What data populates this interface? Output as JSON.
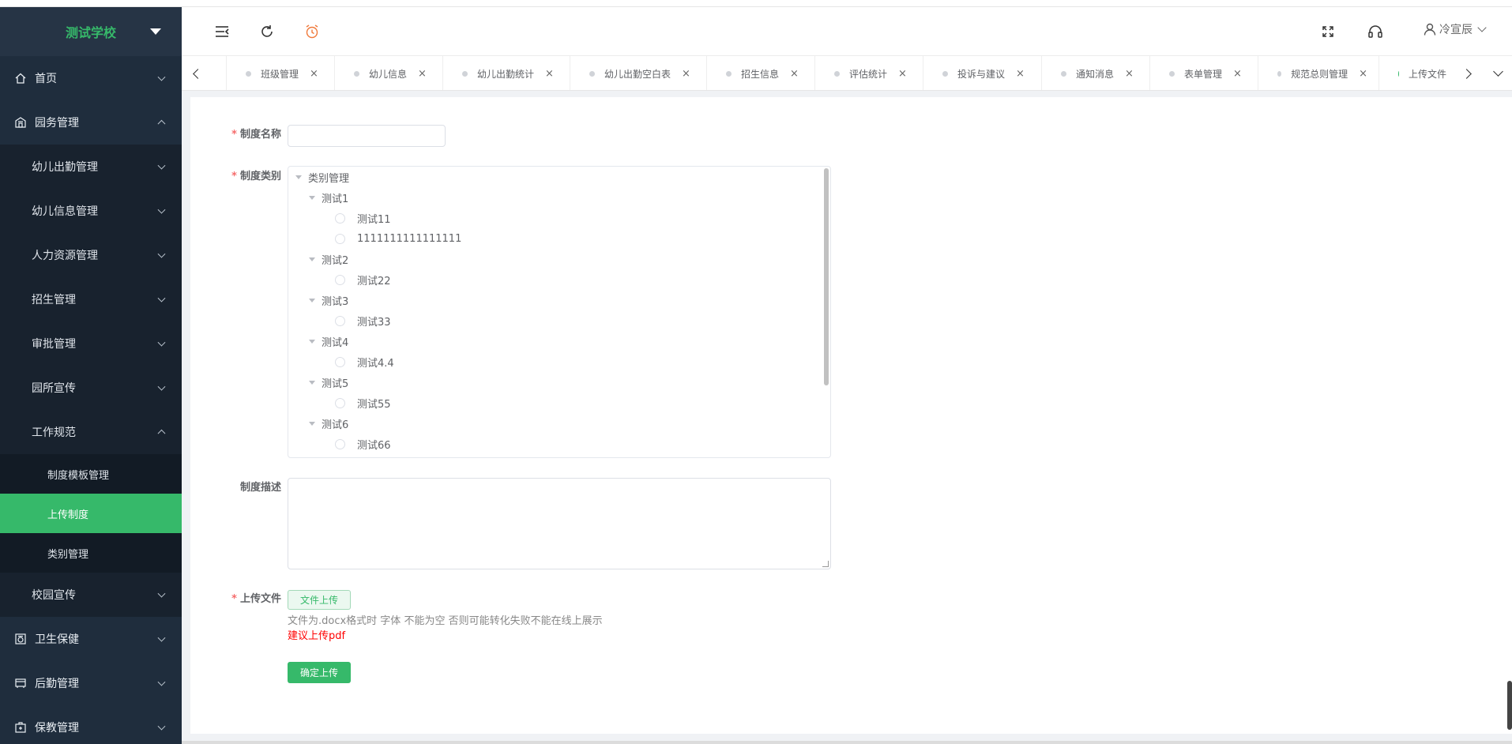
{
  "brand": {
    "title": "测试学校"
  },
  "sidebar": {
    "items": [
      {
        "label": "首页",
        "level": "top",
        "expanded": false,
        "icon": "home-icon"
      },
      {
        "label": "园务管理",
        "level": "top",
        "expanded": true,
        "icon": "building-icon"
      },
      {
        "label": "幼儿出勤管理",
        "level": "sub",
        "expanded": false
      },
      {
        "label": "幼儿信息管理",
        "level": "sub",
        "expanded": false
      },
      {
        "label": "人力资源管理",
        "level": "sub",
        "expanded": false
      },
      {
        "label": "招生管理",
        "level": "sub",
        "expanded": false
      },
      {
        "label": "审批管理",
        "level": "sub",
        "expanded": false
      },
      {
        "label": "园所宣传",
        "level": "sub",
        "expanded": false
      },
      {
        "label": "工作规范",
        "level": "sub",
        "expanded": true
      },
      {
        "label": "制度模板管理",
        "level": "subsub"
      },
      {
        "label": "上传制度",
        "level": "subsub",
        "active": true
      },
      {
        "label": "类别管理",
        "level": "subsub"
      },
      {
        "label": "校园宣传",
        "level": "sub",
        "expanded": false
      },
      {
        "label": "卫生保健",
        "level": "top",
        "expanded": false,
        "icon": "health-icon"
      },
      {
        "label": "后勤管理",
        "level": "top",
        "expanded": false,
        "icon": "logistics-icon"
      },
      {
        "label": "保教管理",
        "level": "top",
        "expanded": false,
        "icon": "education-icon"
      }
    ]
  },
  "header": {
    "user_name": "冷宣辰"
  },
  "tabs": [
    {
      "label": "班级管理"
    },
    {
      "label": "幼儿信息"
    },
    {
      "label": "幼儿出勤统计"
    },
    {
      "label": "幼儿出勤空白表"
    },
    {
      "label": "招生信息"
    },
    {
      "label": "评估统计"
    },
    {
      "label": "投诉与建议"
    },
    {
      "label": "通知消息"
    },
    {
      "label": "表单管理"
    },
    {
      "label": "规范总则管理"
    },
    {
      "label": "上传文件",
      "active": true
    }
  ],
  "form": {
    "name_label": "制度名称",
    "name_value": "",
    "category_label": "制度类别",
    "desc_label": "制度描述",
    "desc_value": "",
    "file_label": "上传文件",
    "upload_button": "文件上传",
    "tip": "文件为.docx格式时 字体 不能为空 否则可能转化失败不能在线上展示",
    "tip_red": "建议上传pdf",
    "submit_button": "确定上传"
  },
  "tree": [
    {
      "label": "类别管理",
      "depth": 0,
      "type": "branch"
    },
    {
      "label": "测试1",
      "depth": 1,
      "type": "branch"
    },
    {
      "label": "测试11",
      "depth": 2,
      "type": "leaf"
    },
    {
      "label": "1111111111111111",
      "depth": 2,
      "type": "leaf"
    },
    {
      "label": "测试2",
      "depth": 1,
      "type": "branch"
    },
    {
      "label": "测试22",
      "depth": 2,
      "type": "leaf"
    },
    {
      "label": "测试3",
      "depth": 1,
      "type": "branch"
    },
    {
      "label": "测试33",
      "depth": 2,
      "type": "leaf"
    },
    {
      "label": "测试4",
      "depth": 1,
      "type": "branch"
    },
    {
      "label": "测试4.4",
      "depth": 2,
      "type": "leaf"
    },
    {
      "label": "测试5",
      "depth": 1,
      "type": "branch"
    },
    {
      "label": "测试55",
      "depth": 2,
      "type": "leaf"
    },
    {
      "label": "测试6",
      "depth": 1,
      "type": "branch"
    },
    {
      "label": "测试66",
      "depth": 2,
      "type": "leaf"
    }
  ],
  "colors": {
    "accent": "#36b96a",
    "sidebar_bg": "#1f2d3d",
    "required": "#f56c6c",
    "warning_text": "#ff0000"
  }
}
